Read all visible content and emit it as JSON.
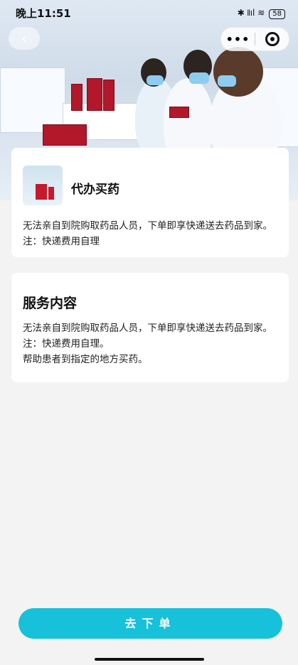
{
  "status_bar": {
    "time": "晚上11:51",
    "signal": "✱ 𝍪ıl ≋",
    "battery": "58"
  },
  "nav": {
    "back_icon": "‹",
    "more_icon": "•••"
  },
  "service_card": {
    "title": "代办买药",
    "description": "无法亲自到院购取药品人员，下单即享快递送去药品到家。注：快递费用自理"
  },
  "content_card": {
    "title": "服务内容",
    "lines": [
      "无法亲自到院购取药品人员，下单即享快递送去药品到家。注：快递费用自理。",
      "帮助患者到指定的地方买药。"
    ]
  },
  "order_button": {
    "label": "去下单"
  },
  "colors": {
    "accent": "#16c1d9",
    "background": "#f3f3f3"
  }
}
